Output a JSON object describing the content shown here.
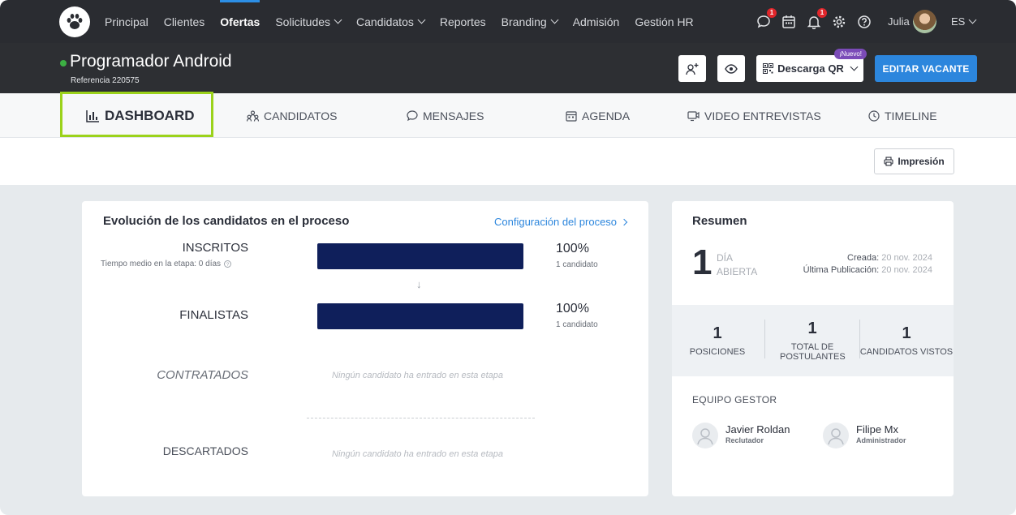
{
  "nav": {
    "links": [
      {
        "label": "Principal",
        "active": false,
        "dropdown": false
      },
      {
        "label": "Clientes",
        "active": false,
        "dropdown": false
      },
      {
        "label": "Ofertas",
        "active": true,
        "dropdown": false
      },
      {
        "label": "Solicitudes",
        "active": false,
        "dropdown": true
      },
      {
        "label": "Candidatos",
        "active": false,
        "dropdown": true
      },
      {
        "label": "Reportes",
        "active": false,
        "dropdown": false
      },
      {
        "label": "Branding",
        "active": false,
        "dropdown": true
      },
      {
        "label": "Admisión",
        "active": false,
        "dropdown": false
      },
      {
        "label": "Gestión HR",
        "active": false,
        "dropdown": false
      }
    ],
    "icons": [
      {
        "name": "chat-icon",
        "badge": "1"
      },
      {
        "name": "calendar-icon",
        "badge": ""
      },
      {
        "name": "bell-icon",
        "badge": "1"
      },
      {
        "name": "gear-icon",
        "badge": ""
      },
      {
        "name": "help-icon",
        "badge": ""
      }
    ],
    "user_name": "Julia",
    "language": "ES"
  },
  "header": {
    "job_title": "Programador Android",
    "reference": "Referencia 220575",
    "qr_button": "Descarga QR",
    "new_badge": "¡Nuevo!",
    "edit_button": "EDITAR VACANTE"
  },
  "tabs": [
    {
      "label": "DASHBOARD",
      "icon": "bar-chart-icon",
      "active": true
    },
    {
      "label": "CANDIDATOS",
      "icon": "people-icon",
      "active": false
    },
    {
      "label": "MENSAJES",
      "icon": "message-icon",
      "active": false
    },
    {
      "label": "AGENDA",
      "icon": "calendar-icon",
      "active": false
    },
    {
      "label": "VIDEO ENTREVISTAS",
      "icon": "video-icon",
      "active": false
    },
    {
      "label": "TIMELINE",
      "icon": "clock-icon",
      "active": false
    }
  ],
  "print_button": "Impresión",
  "evolution": {
    "title": "Evolución de los candidatos en el proceso",
    "config_link": "Configuración del proceso",
    "stages": [
      {
        "name": "INSCRITOS",
        "sub": "Tiempo medio en la etapa: 0 días",
        "percent": "100%",
        "count": "1 candidato",
        "fill": 1.0
      },
      {
        "name": "FINALISTAS",
        "sub": "",
        "percent": "100%",
        "count": "1 candidato",
        "fill": 1.0
      },
      {
        "name": "CONTRATADOS",
        "empty": "Ningún candidato ha entrado en esta etapa"
      },
      {
        "name": "DESCARTADOS",
        "empty": "Ningún candidato ha entrado en esta etapa"
      }
    ]
  },
  "summary": {
    "title": "Resumen",
    "days_value": "1",
    "days_label_1": "DÍA",
    "days_label_2": "ABIERTA",
    "created_label": "Creada:",
    "created_date": "20 nov. 2024",
    "published_label": "Última Publicación:",
    "published_date": "20 nov. 2024",
    "stats": [
      {
        "value": "1",
        "label": "POSICIONES"
      },
      {
        "value": "1",
        "label": "TOTAL DE POSTULANTES"
      },
      {
        "value": "1",
        "label": "CANDIDATOS VISTOS"
      }
    ],
    "team_title": "EQUIPO GESTOR",
    "team": [
      {
        "name": "Javier Roldan",
        "role": "Reclutador"
      },
      {
        "name": "Filipe Mx",
        "role": "Administrador"
      }
    ]
  },
  "colors": {
    "accent": "#2c86dd",
    "bar": "#0f1f5b",
    "highlight": "#9bd21b",
    "status": "#3cb043"
  }
}
